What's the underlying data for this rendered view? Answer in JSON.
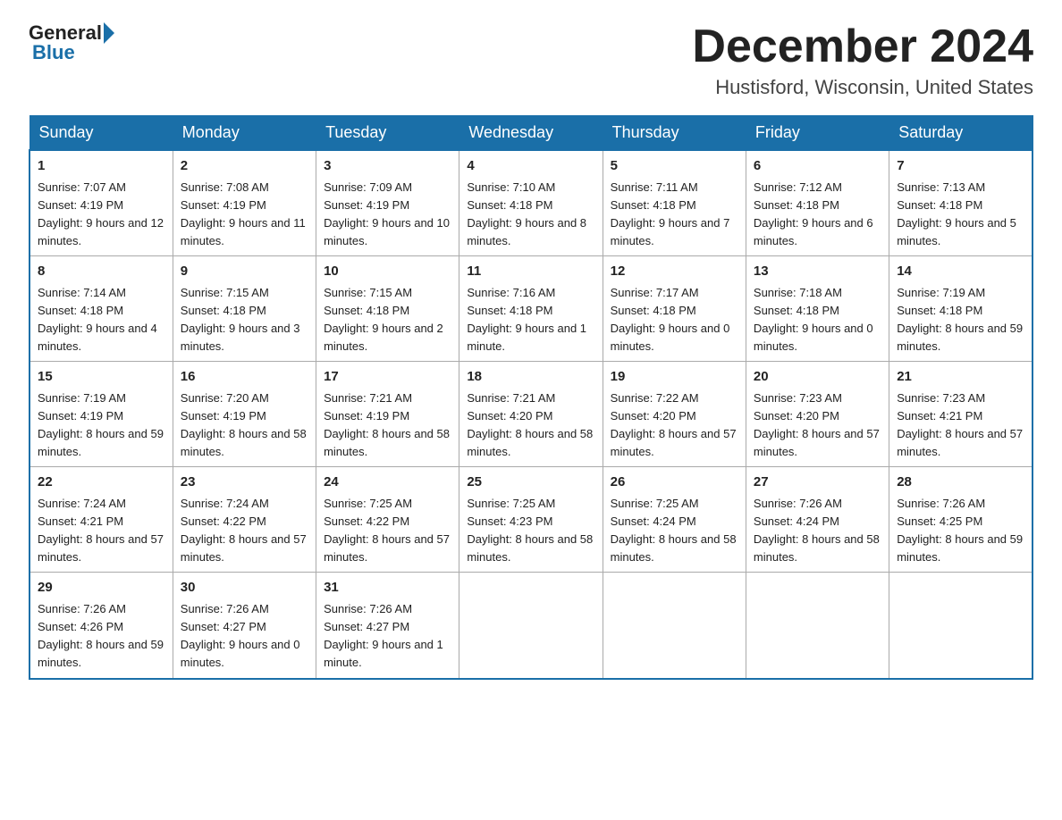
{
  "header": {
    "logo_general": "General",
    "logo_blue": "Blue",
    "month_title": "December 2024",
    "location": "Hustisford, Wisconsin, United States"
  },
  "days_of_week": [
    "Sunday",
    "Monday",
    "Tuesday",
    "Wednesday",
    "Thursday",
    "Friday",
    "Saturday"
  ],
  "weeks": [
    [
      {
        "day": "1",
        "sunrise": "7:07 AM",
        "sunset": "4:19 PM",
        "daylight": "9 hours and 12 minutes."
      },
      {
        "day": "2",
        "sunrise": "7:08 AM",
        "sunset": "4:19 PM",
        "daylight": "9 hours and 11 minutes."
      },
      {
        "day": "3",
        "sunrise": "7:09 AM",
        "sunset": "4:19 PM",
        "daylight": "9 hours and 10 minutes."
      },
      {
        "day": "4",
        "sunrise": "7:10 AM",
        "sunset": "4:18 PM",
        "daylight": "9 hours and 8 minutes."
      },
      {
        "day": "5",
        "sunrise": "7:11 AM",
        "sunset": "4:18 PM",
        "daylight": "9 hours and 7 minutes."
      },
      {
        "day": "6",
        "sunrise": "7:12 AM",
        "sunset": "4:18 PM",
        "daylight": "9 hours and 6 minutes."
      },
      {
        "day": "7",
        "sunrise": "7:13 AM",
        "sunset": "4:18 PM",
        "daylight": "9 hours and 5 minutes."
      }
    ],
    [
      {
        "day": "8",
        "sunrise": "7:14 AM",
        "sunset": "4:18 PM",
        "daylight": "9 hours and 4 minutes."
      },
      {
        "day": "9",
        "sunrise": "7:15 AM",
        "sunset": "4:18 PM",
        "daylight": "9 hours and 3 minutes."
      },
      {
        "day": "10",
        "sunrise": "7:15 AM",
        "sunset": "4:18 PM",
        "daylight": "9 hours and 2 minutes."
      },
      {
        "day": "11",
        "sunrise": "7:16 AM",
        "sunset": "4:18 PM",
        "daylight": "9 hours and 1 minute."
      },
      {
        "day": "12",
        "sunrise": "7:17 AM",
        "sunset": "4:18 PM",
        "daylight": "9 hours and 0 minutes."
      },
      {
        "day": "13",
        "sunrise": "7:18 AM",
        "sunset": "4:18 PM",
        "daylight": "9 hours and 0 minutes."
      },
      {
        "day": "14",
        "sunrise": "7:19 AM",
        "sunset": "4:18 PM",
        "daylight": "8 hours and 59 minutes."
      }
    ],
    [
      {
        "day": "15",
        "sunrise": "7:19 AM",
        "sunset": "4:19 PM",
        "daylight": "8 hours and 59 minutes."
      },
      {
        "day": "16",
        "sunrise": "7:20 AM",
        "sunset": "4:19 PM",
        "daylight": "8 hours and 58 minutes."
      },
      {
        "day": "17",
        "sunrise": "7:21 AM",
        "sunset": "4:19 PM",
        "daylight": "8 hours and 58 minutes."
      },
      {
        "day": "18",
        "sunrise": "7:21 AM",
        "sunset": "4:20 PM",
        "daylight": "8 hours and 58 minutes."
      },
      {
        "day": "19",
        "sunrise": "7:22 AM",
        "sunset": "4:20 PM",
        "daylight": "8 hours and 57 minutes."
      },
      {
        "day": "20",
        "sunrise": "7:23 AM",
        "sunset": "4:20 PM",
        "daylight": "8 hours and 57 minutes."
      },
      {
        "day": "21",
        "sunrise": "7:23 AM",
        "sunset": "4:21 PM",
        "daylight": "8 hours and 57 minutes."
      }
    ],
    [
      {
        "day": "22",
        "sunrise": "7:24 AM",
        "sunset": "4:21 PM",
        "daylight": "8 hours and 57 minutes."
      },
      {
        "day": "23",
        "sunrise": "7:24 AM",
        "sunset": "4:22 PM",
        "daylight": "8 hours and 57 minutes."
      },
      {
        "day": "24",
        "sunrise": "7:25 AM",
        "sunset": "4:22 PM",
        "daylight": "8 hours and 57 minutes."
      },
      {
        "day": "25",
        "sunrise": "7:25 AM",
        "sunset": "4:23 PM",
        "daylight": "8 hours and 58 minutes."
      },
      {
        "day": "26",
        "sunrise": "7:25 AM",
        "sunset": "4:24 PM",
        "daylight": "8 hours and 58 minutes."
      },
      {
        "day": "27",
        "sunrise": "7:26 AM",
        "sunset": "4:24 PM",
        "daylight": "8 hours and 58 minutes."
      },
      {
        "day": "28",
        "sunrise": "7:26 AM",
        "sunset": "4:25 PM",
        "daylight": "8 hours and 59 minutes."
      }
    ],
    [
      {
        "day": "29",
        "sunrise": "7:26 AM",
        "sunset": "4:26 PM",
        "daylight": "8 hours and 59 minutes."
      },
      {
        "day": "30",
        "sunrise": "7:26 AM",
        "sunset": "4:27 PM",
        "daylight": "9 hours and 0 minutes."
      },
      {
        "day": "31",
        "sunrise": "7:26 AM",
        "sunset": "4:27 PM",
        "daylight": "9 hours and 1 minute."
      },
      null,
      null,
      null,
      null
    ]
  ],
  "labels": {
    "sunrise": "Sunrise:",
    "sunset": "Sunset:",
    "daylight": "Daylight:"
  }
}
